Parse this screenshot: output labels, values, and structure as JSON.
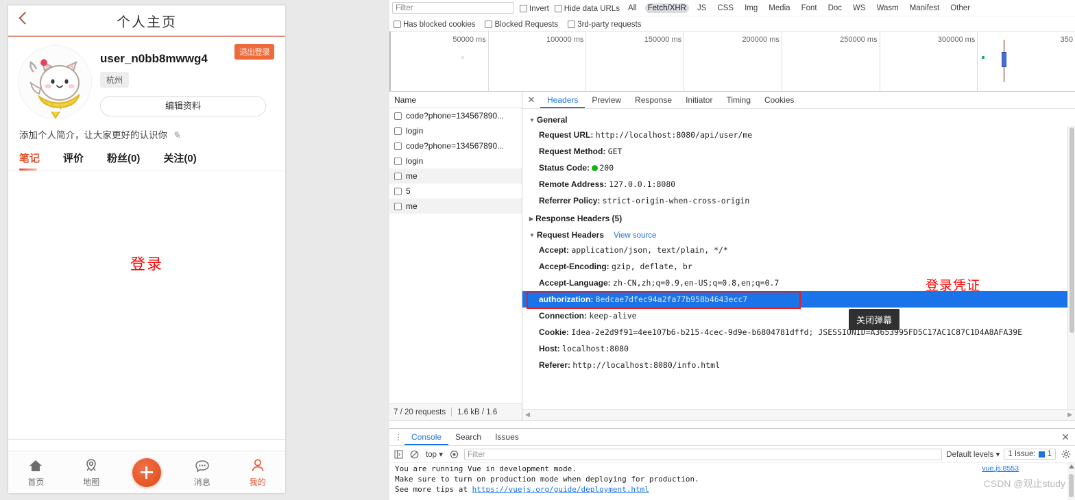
{
  "phone": {
    "header": {
      "title": "个人主页",
      "back_icon": "chevron-left-icon"
    },
    "profile": {
      "avatar_icon": "cat-avatar-image",
      "username": "user_n0bb8mwwg4",
      "city": "杭州",
      "edit_button": "编辑资料",
      "logout_button": "退出登录",
      "bio_placeholder": "添加个人简介，让大家更好的认识你",
      "bio_edit_icon": "pencil-icon"
    },
    "tabs": [
      {
        "label": "笔记",
        "active": true
      },
      {
        "label": "评价",
        "active": false
      },
      {
        "label": "粉丝(0)",
        "active": false
      },
      {
        "label": "关注(0)",
        "active": false
      }
    ],
    "feed_annotation": "登录",
    "tabbar": [
      {
        "label": "首页",
        "icon": "home-icon",
        "active": false
      },
      {
        "label": "地图",
        "icon": "map-pin-icon",
        "active": false
      },
      {
        "label": "",
        "icon": "plus-button-icon",
        "active": false
      },
      {
        "label": "消息",
        "icon": "chat-bubble-icon",
        "active": false
      },
      {
        "label": "我的",
        "icon": "person-icon",
        "active": true
      }
    ]
  },
  "devtools": {
    "filterbar": {
      "filter_placeholder": "Filter",
      "invert_label": "Invert",
      "hide_data_urls_label": "Hide data URLs",
      "types": [
        {
          "label": "All",
          "selected": false
        },
        {
          "label": "Fetch/XHR",
          "selected": true
        },
        {
          "label": "JS",
          "selected": false
        },
        {
          "label": "CSS",
          "selected": false
        },
        {
          "label": "Img",
          "selected": false
        },
        {
          "label": "Media",
          "selected": false
        },
        {
          "label": "Font",
          "selected": false
        },
        {
          "label": "Doc",
          "selected": false
        },
        {
          "label": "WS",
          "selected": false
        },
        {
          "label": "Wasm",
          "selected": false
        },
        {
          "label": "Manifest",
          "selected": false
        },
        {
          "label": "Other",
          "selected": false
        }
      ],
      "row2": [
        "Has blocked cookies",
        "Blocked Requests",
        "3rd-party requests"
      ]
    },
    "overview": {
      "ticks": [
        "50000 ms",
        "100000 ms",
        "150000 ms",
        "200000 ms",
        "250000 ms",
        "300000 ms",
        "350"
      ]
    },
    "requests": {
      "column_header": "Name",
      "rows": [
        {
          "name": "code?phone=134567890...",
          "selected": false
        },
        {
          "name": "login",
          "selected": false
        },
        {
          "name": "code?phone=134567890...",
          "selected": false
        },
        {
          "name": "login",
          "selected": false
        },
        {
          "name": "me",
          "selected": true
        },
        {
          "name": "5",
          "selected": false
        },
        {
          "name": "me",
          "selected": true
        }
      ],
      "status_requests": "7 / 20 requests",
      "status_transferred": "1.6 kB / 1.6"
    },
    "tooltip": "关闭弹幕",
    "detail": {
      "close_icon": "close-icon",
      "tabs": [
        {
          "label": "Headers",
          "active": true
        },
        {
          "label": "Preview",
          "active": false
        },
        {
          "label": "Response",
          "active": false
        },
        {
          "label": "Initiator",
          "active": false
        },
        {
          "label": "Timing",
          "active": false
        },
        {
          "label": "Cookies",
          "active": false
        }
      ],
      "general": {
        "title": "General",
        "rows": [
          {
            "key": "Request URL:",
            "value": "http://localhost:8080/api/user/me"
          },
          {
            "key": "Request Method:",
            "value": "GET"
          },
          {
            "key": "Status Code:",
            "value": "200",
            "status": true
          },
          {
            "key": "Remote Address:",
            "value": "127.0.0.1:8080"
          },
          {
            "key": "Referrer Policy:",
            "value": "strict-origin-when-cross-origin"
          }
        ]
      },
      "response_headers_title": "Response Headers (5)",
      "request_headers_title": "Request Headers",
      "view_source": "View source",
      "request_headers": [
        {
          "key": "Accept:",
          "value": "application/json, text/plain, */*"
        },
        {
          "key": "Accept-Encoding:",
          "value": "gzip, deflate, br"
        },
        {
          "key": "Accept-Language:",
          "value": "zh-CN,zh;q=0.9,en-US;q=0.8,en;q=0.7"
        },
        {
          "key": "authorization:",
          "value": "8edcae7dfec94a2fa77b958b4643ecc7",
          "highlighted": true
        },
        {
          "key": "Connection:",
          "value": "keep-alive"
        },
        {
          "key": "Cookie:",
          "value": "Idea-2e2d9f91=4ee107b6-b215-4cec-9d9e-b6804781dffd; JSESSIONID=A3653995FD5C17AC1C87C1D4A8AFA39E"
        },
        {
          "key": "Host:",
          "value": "localhost:8080"
        },
        {
          "key": "Referer:",
          "value": "http://localhost:8080/info.html"
        }
      ],
      "annotation": "登录凭证",
      "annotation_color": "#fe0000"
    },
    "drawer": {
      "tabs": [
        {
          "label": "Console",
          "active": true
        },
        {
          "label": "Search",
          "active": false
        },
        {
          "label": "Issues",
          "active": false
        }
      ],
      "close_icon": "close-icon",
      "toolbar": {
        "context": "top",
        "filter_placeholder": "Filter",
        "levels": "Default levels",
        "issues": "1 Issue:",
        "issues_count": "1",
        "settings_icon": "gear-icon"
      },
      "log_lines": [
        "You are running Vue in development mode.",
        "Make sure to turn on production mode when deploying for production.",
        "See more tips at "
      ],
      "log_link": "https://vuejs.org/guide/deployment.html",
      "log_source": "vue.js:8553"
    }
  },
  "watermark": "CSDN @观止study"
}
